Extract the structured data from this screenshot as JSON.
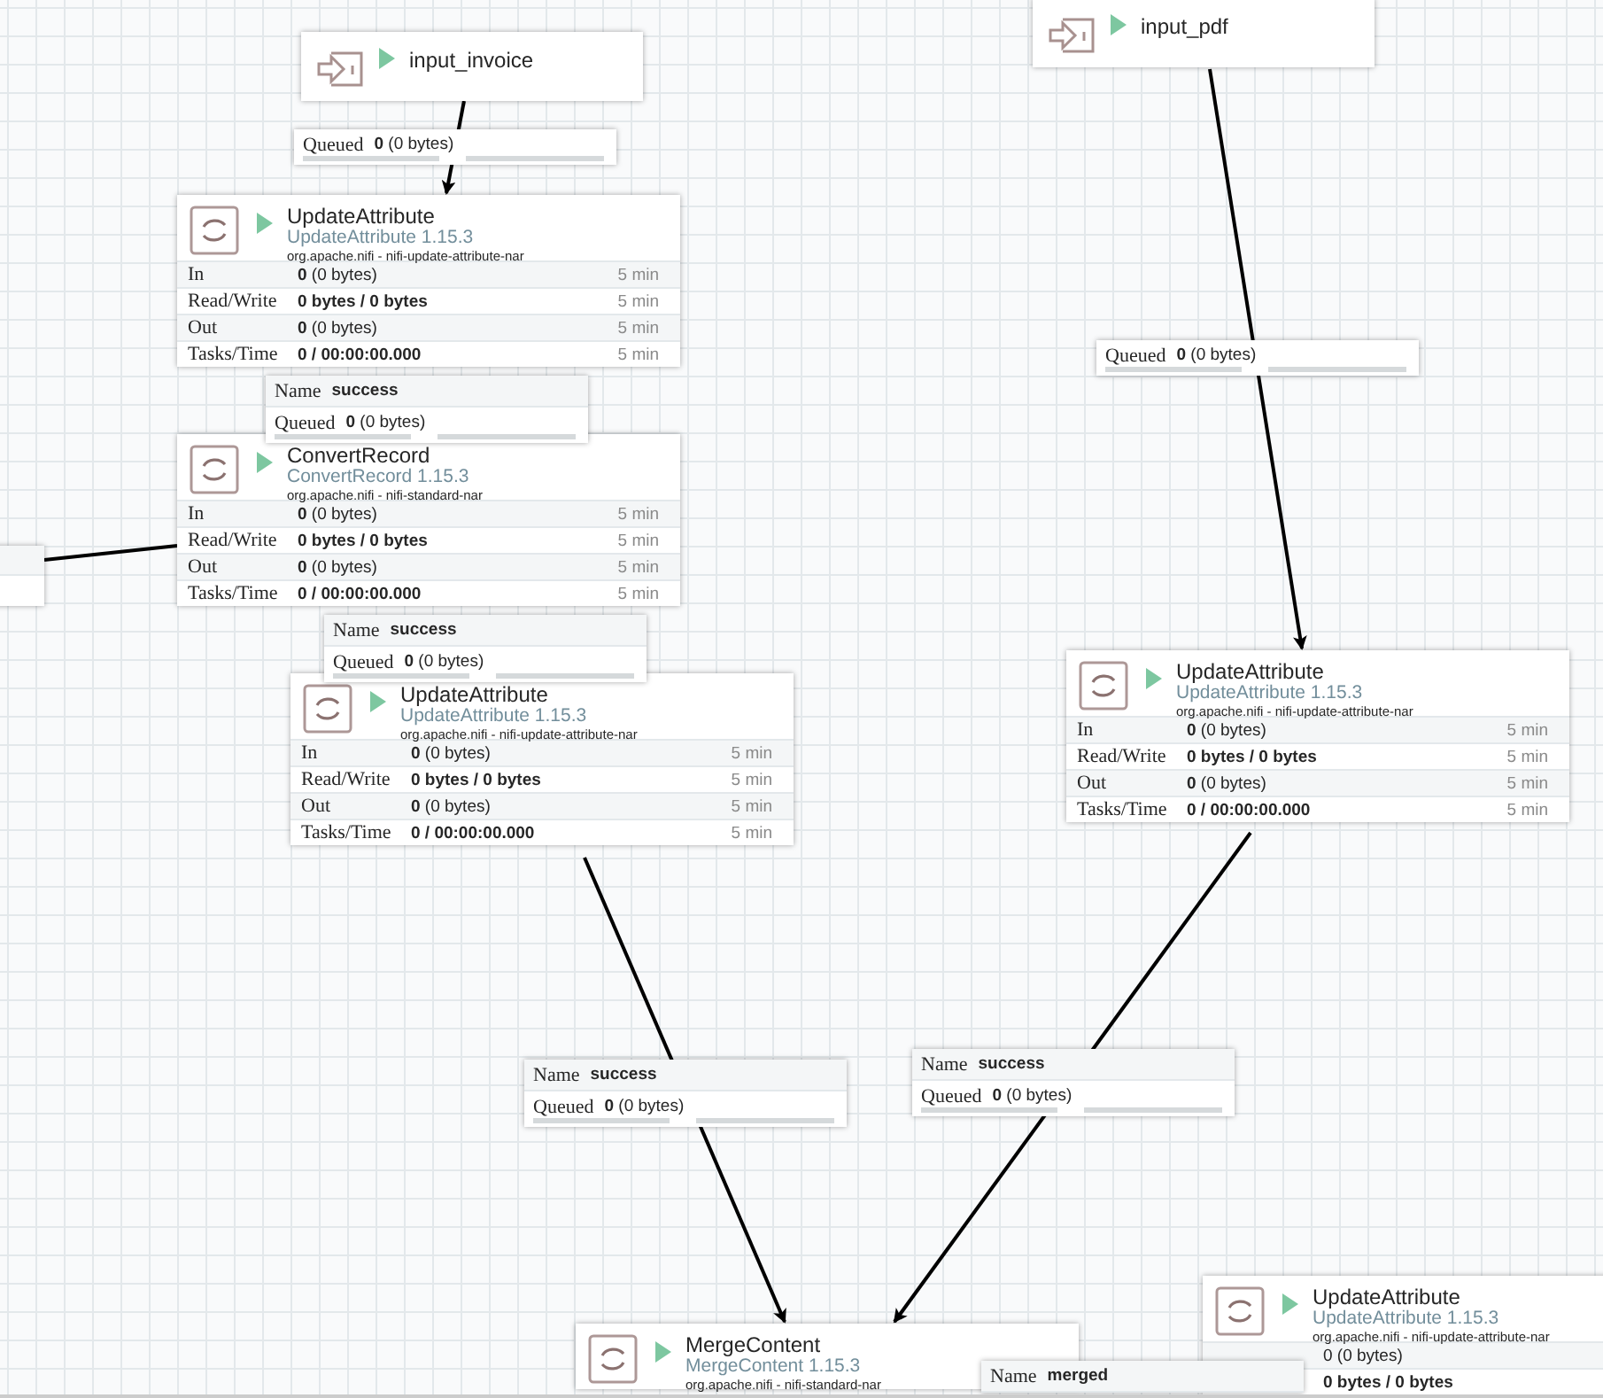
{
  "ports": [
    {
      "name": "input_invoice",
      "running": true
    },
    {
      "name": "input_pdf",
      "running": true
    }
  ],
  "processors": [
    {
      "name": "UpdateAttribute",
      "type": "UpdateAttribute 1.15.3",
      "bundle": "org.apache.nifi - nifi-update-attribute-nar",
      "running": true,
      "stats": [
        {
          "kind": "count",
          "label": "In",
          "value": "**0** (0 bytes)",
          "window": "5 min"
        },
        {
          "kind": "total",
          "label": "Read/Write",
          "value": "0 bytes / 0 bytes",
          "window": "5 min"
        },
        {
          "kind": "count",
          "label": "Out",
          "value": "**0** (0 bytes)",
          "window": "5 min"
        },
        {
          "kind": "total",
          "label": "Tasks/Time",
          "value": "0 / 00:00:00.000",
          "window": "5 min"
        }
      ]
    },
    {
      "name": "ConvertRecord",
      "type": "ConvertRecord 1.15.3",
      "bundle": "org.apache.nifi - nifi-standard-nar",
      "running": true,
      "stats": [
        {
          "kind": "count",
          "label": "In",
          "value": "**0** (0 bytes)",
          "window": "5 min"
        },
        {
          "kind": "total",
          "label": "Read/Write",
          "value": "0 bytes / 0 bytes",
          "window": "5 min"
        },
        {
          "kind": "count",
          "label": "Out",
          "value": "**0** (0 bytes)",
          "window": "5 min"
        },
        {
          "kind": "total",
          "label": "Tasks/Time",
          "value": "0 / 00:00:00.000",
          "window": "5 min"
        }
      ]
    },
    {
      "name": "UpdateAttribute",
      "type": "UpdateAttribute 1.15.3",
      "bundle": "org.apache.nifi - nifi-update-attribute-nar",
      "running": true,
      "stats": [
        {
          "kind": "count",
          "label": "In",
          "value": "**0** (0 bytes)",
          "window": "5 min"
        },
        {
          "kind": "total",
          "label": "Read/Write",
          "value": "0 bytes / 0 bytes",
          "window": "5 min"
        },
        {
          "kind": "count",
          "label": "Out",
          "value": "**0** (0 bytes)",
          "window": "5 min"
        },
        {
          "kind": "total",
          "label": "Tasks/Time",
          "value": "0 / 00:00:00.000",
          "window": "5 min"
        }
      ]
    },
    {
      "name": "UpdateAttribute",
      "type": "UpdateAttribute 1.15.3",
      "bundle": "org.apache.nifi - nifi-update-attribute-nar",
      "running": true,
      "stats": [
        {
          "kind": "count",
          "label": "In",
          "value": "**0** (0 bytes)",
          "window": "5 min"
        },
        {
          "kind": "total",
          "label": "Read/Write",
          "value": "0 bytes / 0 bytes",
          "window": "5 min"
        },
        {
          "kind": "count",
          "label": "Out",
          "value": "**0** (0 bytes)",
          "window": "5 min"
        },
        {
          "kind": "total",
          "label": "Tasks/Time",
          "value": "0 / 00:00:00.000",
          "window": "5 min"
        }
      ]
    },
    {
      "name": "MergeContent",
      "type": "MergeContent 1.15.3",
      "bundle": "org.apache.nifi - nifi-standard-nar",
      "running": true
    },
    {
      "name": "UpdateAttribute",
      "type": "UpdateAttribute 1.15.3",
      "bundle": "org.apache.nifi - nifi-update-attribute-nar",
      "running": true,
      "stats": [
        {
          "kind": "count",
          "value": "0 (0 bytes)"
        },
        {
          "kind": "total",
          "value": "0 bytes / 0 bytes"
        }
      ]
    }
  ],
  "connections": [
    {
      "rows": [
        {
          "kind": "queued",
          "label": "Queued",
          "value": "**0** (0 bytes)"
        }
      ]
    },
    {
      "rows": [
        {
          "kind": "name",
          "label": "Name",
          "value": "success"
        },
        {
          "kind": "queued",
          "label": "Queued",
          "value": "**0** (0 bytes)"
        }
      ]
    },
    {
      "rows": [
        {
          "kind": "name",
          "label": "Name",
          "value": "success"
        },
        {
          "kind": "queued",
          "label": "Queued",
          "value": "**0** (0 bytes)"
        }
      ]
    },
    {
      "rows": [
        {
          "kind": "queued",
          "label": "Queued",
          "value": "**0** (0 bytes)"
        }
      ]
    },
    {
      "rows": [
        {
          "kind": "name",
          "label": "Name",
          "value": "success"
        },
        {
          "kind": "queued",
          "label": "Queued",
          "value": "**0** (0 bytes)"
        }
      ]
    },
    {
      "rows": [
        {
          "kind": "name",
          "label": "Name",
          "value": "success"
        },
        {
          "kind": "queued",
          "label": "Queued",
          "value": "**0** (0 bytes)"
        }
      ]
    },
    {
      "rows": [
        {
          "kind": "name",
          "label": "Name",
          "value": "merged"
        }
      ]
    }
  ]
}
